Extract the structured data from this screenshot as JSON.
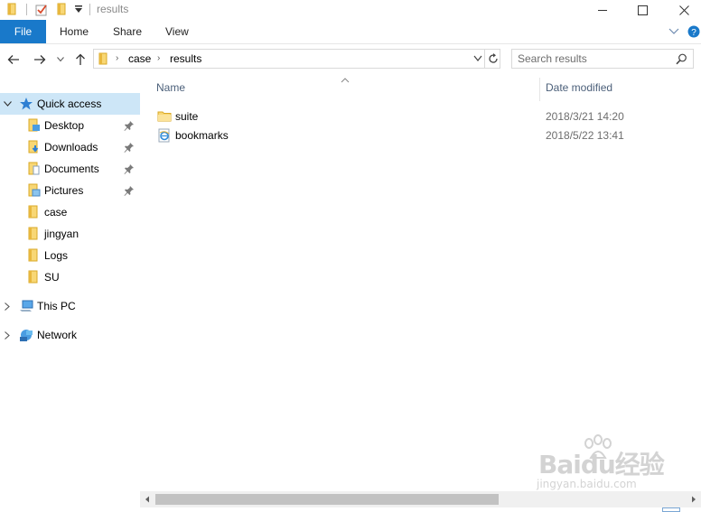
{
  "window": {
    "title": "results"
  },
  "ribbon": {
    "tabs": [
      {
        "label": "File"
      },
      {
        "label": "Home"
      },
      {
        "label": "Share"
      },
      {
        "label": "View"
      }
    ]
  },
  "address": {
    "crumbs": [
      "case",
      "results"
    ]
  },
  "search": {
    "placeholder": "Search results"
  },
  "navpane": {
    "quick_access": "Quick access",
    "items": [
      {
        "label": "Desktop",
        "pinned": true,
        "icon": "desktop-folder-icon"
      },
      {
        "label": "Downloads",
        "pinned": true,
        "icon": "downloads-folder-icon"
      },
      {
        "label": "Documents",
        "pinned": true,
        "icon": "documents-folder-icon"
      },
      {
        "label": "Pictures",
        "pinned": true,
        "icon": "pictures-folder-icon"
      },
      {
        "label": "case",
        "pinned": false,
        "icon": "folder-icon"
      },
      {
        "label": "jingyan",
        "pinned": false,
        "icon": "folder-icon"
      },
      {
        "label": "Logs",
        "pinned": false,
        "icon": "folder-icon"
      },
      {
        "label": "SU",
        "pinned": false,
        "icon": "folder-icon"
      }
    ],
    "this_pc": "This PC",
    "network": "Network"
  },
  "content": {
    "columns": [
      "Name",
      "Date modified"
    ],
    "files": [
      {
        "name": "suite",
        "date": "2018/3/21 14:20",
        "type": "folder"
      },
      {
        "name": "bookmarks",
        "date": "2018/5/22 13:41",
        "type": "html-document"
      }
    ]
  },
  "watermark": {
    "text": "Baidu经验",
    "sub": "jingyan.baidu.com"
  },
  "colors": {
    "accent": "#1979ca",
    "selection": "#cde6f7",
    "folder": "#f8d775"
  }
}
